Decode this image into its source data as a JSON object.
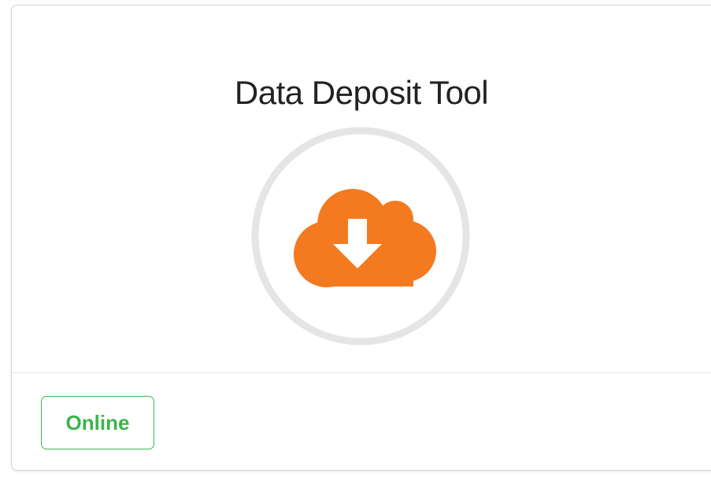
{
  "card": {
    "title": "Data Deposit Tool",
    "icon": "cloud-download-icon",
    "status_label": "Online"
  },
  "colors": {
    "icon_orange": "#f47a20",
    "ring_gray": "#e5e5e5",
    "status_green": "#3cb54a"
  }
}
